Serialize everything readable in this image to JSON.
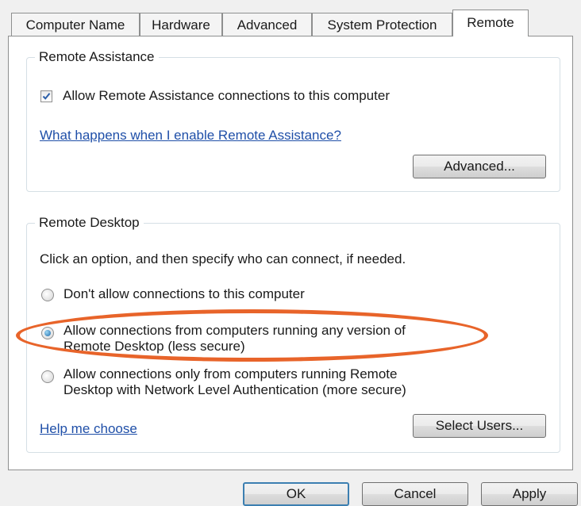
{
  "tabs": [
    {
      "label": "Computer Name",
      "active": false
    },
    {
      "label": "Hardware",
      "active": false
    },
    {
      "label": "Advanced",
      "active": false
    },
    {
      "label": "System Protection",
      "active": false
    },
    {
      "label": "Remote",
      "active": true
    }
  ],
  "remote_assistance": {
    "title": "Remote Assistance",
    "allow_checkbox_label": "Allow Remote Assistance connections to this computer",
    "allow_checked": true,
    "help_link": "What happens when I enable Remote Assistance?",
    "advanced_button": "Advanced..."
  },
  "remote_desktop": {
    "title": "Remote Desktop",
    "instruction": "Click an option, and then specify who can connect, if needed.",
    "options": [
      {
        "line1": "Don't allow connections to this computer",
        "line2": "",
        "selected": false
      },
      {
        "line1": "Allow connections from computers running any version of",
        "line2": "Remote Desktop (less secure)",
        "selected": true
      },
      {
        "line1": "Allow connections only from computers running Remote",
        "line2": "Desktop with Network Level Authentication (more secure)",
        "selected": false
      }
    ],
    "help_link": "Help me choose",
    "select_users_button": "Select Users..."
  },
  "footer": {
    "ok": "OK",
    "cancel": "Cancel",
    "apply": "Apply"
  },
  "colors": {
    "highlight": "#e8642a",
    "link": "#1f4fa8"
  }
}
